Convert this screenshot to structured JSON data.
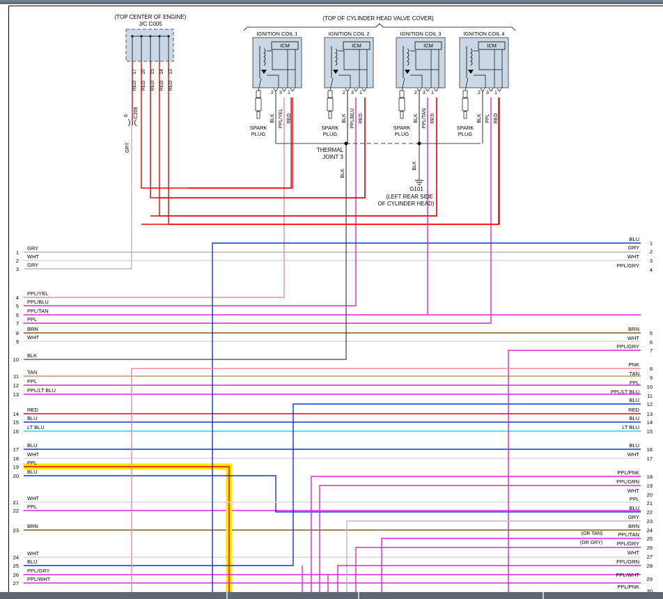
{
  "header_labels": {
    "jc_location": "(TOP CENTER OF ENGINE)",
    "jc_name": "J/C C005",
    "coil_location": "(TOP OF CYLINDER HEAD VALVE COVER)",
    "thermal_joint": [
      "THERMAL",
      "JOINT 3"
    ],
    "ground_name": "G101",
    "ground_location": [
      "(LEFT REAR SIDE",
      "OF CYLINDER HEAD)"
    ],
    "connector_c208": "C208",
    "icm": "ICM",
    "spark_plug": [
      "SPARK",
      "PLUG"
    ]
  },
  "jc_pins": [
    "17",
    "16",
    "15",
    "14",
    "13"
  ],
  "jc_wire_colors": [
    "RED",
    "RED",
    "RED",
    "RED",
    "RED"
  ],
  "c208_pin": "6",
  "gry_label": "GRY",
  "coils": [
    {
      "name": "IGNITION COIL 1",
      "pins": [
        "2",
        "3",
        "1"
      ],
      "wires": [
        "BLK",
        "PPL/YEL",
        "RED"
      ]
    },
    {
      "name": "IGNITION COIL 2",
      "pins": [
        "2",
        "3",
        "1"
      ],
      "wires": [
        "BLK",
        "PPL/BLU",
        "RED"
      ]
    },
    {
      "name": "IGNITION COIL 3",
      "pins": [
        "2",
        "3",
        "1"
      ],
      "wires": [
        "BLK",
        "PPL/TAN",
        "RED"
      ]
    },
    {
      "name": "IGNITION COIL 4",
      "pins": [
        "2",
        "3",
        "1"
      ],
      "wires": [
        "BLK",
        "PPL",
        "RED"
      ]
    }
  ],
  "blk_labels": {
    "thermal": "BLK",
    "ground": "BLK"
  },
  "left_connector": [
    {
      "num": "1",
      "label": "GRY"
    },
    {
      "num": "2",
      "label": "WHT"
    },
    {
      "num": "3",
      "label": "GRY"
    },
    {
      "num": "4",
      "label": "PPL/YEL"
    },
    {
      "num": "5",
      "label": "PPL/BLU"
    },
    {
      "num": "6",
      "label": "PPL/TAN"
    },
    {
      "num": "7",
      "label": "PPL"
    },
    {
      "num": "8",
      "label": "BRN"
    },
    {
      "num": "9",
      "label": "WHT"
    },
    {
      "num": "10",
      "label": "BLK"
    },
    {
      "num": "11",
      "label": "TAN"
    },
    {
      "num": "12",
      "label": "PPL"
    },
    {
      "num": "13",
      "label": "PPL/LT BLU"
    },
    {
      "num": "14",
      "label": "RED"
    },
    {
      "num": "15",
      "label": "BLU"
    },
    {
      "num": "16",
      "label": "LT BLU"
    },
    {
      "num": "17",
      "label": "BLU"
    },
    {
      "num": "18",
      "label": "WHT"
    },
    {
      "num": "19",
      "label": "PPL"
    },
    {
      "num": "20",
      "label": "BLU"
    },
    {
      "num": "21",
      "label": "WHT"
    },
    {
      "num": "22",
      "label": "PPL"
    },
    {
      "num": "23",
      "label": "BRN"
    },
    {
      "num": "24",
      "label": "WHT"
    },
    {
      "num": "25",
      "label": "BLU"
    },
    {
      "num": "26",
      "label": "PPL/GRY"
    },
    {
      "num": "27",
      "label": "PPL/WHT"
    }
  ],
  "right_connector": [
    {
      "num": "1",
      "label": "BLU"
    },
    {
      "num": "2",
      "label": "GRY"
    },
    {
      "num": "3",
      "label": "WHT"
    },
    {
      "num": "4",
      "label": "PPL/GRY"
    },
    {
      "num": "5",
      "label": "BRN"
    },
    {
      "num": "6",
      "label": "WHT"
    },
    {
      "num": "7",
      "label": "PPL/GRY"
    },
    {
      "num": "8",
      "label": "PNK"
    },
    {
      "num": "9",
      "label": "TAN"
    },
    {
      "num": "10",
      "label": "PPL"
    },
    {
      "num": "11",
      "label": "PPL/LT BLU"
    },
    {
      "num": "12",
      "label": "BLU"
    },
    {
      "num": "13",
      "label": "RED"
    },
    {
      "num": "14",
      "label": "BLU"
    },
    {
      "num": "15",
      "label": "LT BLU"
    },
    {
      "num": "16",
      "label": "BLU"
    },
    {
      "num": "17",
      "label": "WHT"
    },
    {
      "num": "18",
      "label": "PPL/PNK"
    },
    {
      "num": "19",
      "label": "PPL/GRN"
    },
    {
      "num": "20",
      "label": "WHT"
    },
    {
      "num": "21",
      "label": "PPL"
    },
    {
      "num": "22",
      "label": "BLU"
    },
    {
      "num": "23",
      "label": "GRY"
    },
    {
      "num": "24",
      "label": "BRN"
    },
    {
      "num": "25",
      "label": "PPL/TAN"
    },
    {
      "num": "26",
      "label": "PPL/GRY"
    },
    {
      "num": "27",
      "label": "WHT"
    },
    {
      "num": "28",
      "label": "PPL/GRN"
    },
    {
      "num": "29",
      "label": "PPL/WHT"
    },
    {
      "num": "30",
      "label": "PPL/PNK"
    }
  ],
  "alt_notes": [
    "(OR TAN)",
    "(OR GRY)"
  ],
  "wire_colors": {
    "RED": "#ee0000",
    "BLU": "#1030d8",
    "GRY": "#b8b8b8",
    "WHT": "#d8d8d8",
    "PPL": "#e020e0",
    "PNK": "#f08a9a",
    "BRN": "#7a5a10",
    "TAN": "#b89a6a",
    "LTBLU": "#18d8e8",
    "BLK": "#404040",
    "HIGHLIGHT": "#ffe800"
  }
}
